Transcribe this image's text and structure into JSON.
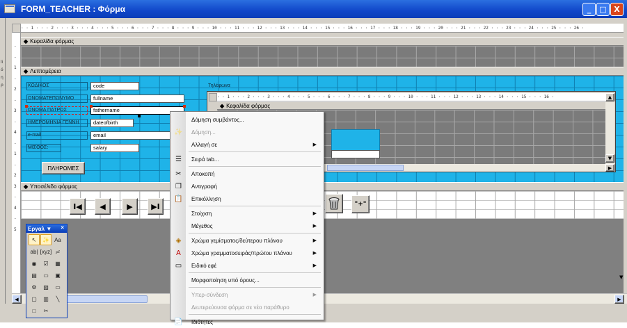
{
  "window": {
    "title": "FORM_TEACHER : Φόρμα",
    "min": "_",
    "max": "□",
    "close": "X"
  },
  "ruler": {
    "text": "· · 1 · · · 2 · · · 3 · · · 4 · · · 5 · · · 6 · · · 7 · · · 8 · · · 9 · · · 10 · · · 11 · · · 12 · · · 13 · · · 14 · · · 15 · · · 16 · · · 17 · · · 18 · · · 19 · · · 20 · · · 21 · · · 22 · · · 23 · · · 24 · · · 25 · · · 26 ·"
  },
  "sections": {
    "header": "Κεφαλίδα φόρμας",
    "detail": "Λεπτομέρεια",
    "footer": "Υποσέλιδο φόρμας"
  },
  "fields": [
    {
      "label": "ΚΩΔΙΚΟΣ",
      "value": "code"
    },
    {
      "label": "ΟΝΟΜΑΤΕΠΩΝΥΜΟ",
      "value": "fullname"
    },
    {
      "label": "ΟΝΟΜΑ ΠΑΤΡΟΣ",
      "value": "fathername"
    },
    {
      "label": "ΗΜΕΡΟΜΗΝΙΑ ΓΕΝΝΗ",
      "value": "dateofbirth"
    },
    {
      "label": "e-mail",
      "value": "email"
    },
    {
      "label": "ΜΙΣΘΟΣ:",
      "value": "salary"
    }
  ],
  "payments_button": "ΠΛΗΡΩΜΕΣ",
  "phones_label": "Τηλέφωνα",
  "subform": {
    "ruler": "· · 1 · · · 2 · · · 3 · · · 4 · · · 5 · · · 6 · · · 7 · · · 8 · · · 9 · · · 10 · · · 11 · · · 12 · · · 13 · · · 14 · · · 15 · · · 16 ·",
    "header": "Κεφαλίδα φόρμας"
  },
  "nav": {
    "first": "I◀",
    "prev": "◀",
    "next": "▶",
    "last": "▶I",
    "add": "\"+\""
  },
  "left_marks": [
    "li",
    "ό",
    "η",
    "ρ"
  ],
  "vruler": {
    "marks": [
      "-",
      "-",
      "1",
      "-",
      "2",
      "-",
      "3",
      "-",
      "4",
      "-",
      "1",
      "-",
      "2",
      "3",
      "-",
      "4",
      "-",
      "5"
    ]
  },
  "context_menu": {
    "items": [
      {
        "label": "Δόμηση συμβάντος...",
        "icon": "",
        "disabled": false,
        "arrow": false
      },
      {
        "label": "Δόμηση...",
        "icon": "wand-icon",
        "disabled": true,
        "arrow": false
      },
      {
        "label": "Αλλαγή σε",
        "icon": "",
        "disabled": false,
        "arrow": true
      },
      {
        "label": "Σειρά tab...",
        "icon": "tab-order-icon",
        "disabled": false,
        "arrow": false
      },
      {
        "label": "Αποκοπή",
        "icon": "scissors-icon",
        "disabled": false,
        "arrow": false
      },
      {
        "label": "Αντιγραφή",
        "icon": "copy-icon",
        "disabled": false,
        "arrow": false
      },
      {
        "label": "Επικόλληση",
        "icon": "paste-icon",
        "disabled": false,
        "arrow": false
      },
      {
        "label": "Στοίχιση",
        "icon": "",
        "disabled": false,
        "arrow": true
      },
      {
        "label": "Μέγεθος",
        "icon": "",
        "disabled": false,
        "arrow": true
      },
      {
        "label": "Χρώμα γεμίσματος/δεύτερου πλάνου",
        "icon": "fill-color-icon",
        "disabled": false,
        "arrow": true
      },
      {
        "label": "Χρώμα γραμματοσειράς/πρώτου πλάνου",
        "icon": "font-color-icon",
        "disabled": false,
        "arrow": true
      },
      {
        "label": "Ειδικό εφέ",
        "icon": "special-effect-icon",
        "disabled": false,
        "arrow": true
      },
      {
        "label": "Μορφοποίηση υπό όρους...",
        "icon": "",
        "disabled": false,
        "arrow": false
      },
      {
        "label": "Υπερ-σύνδεση",
        "icon": "",
        "disabled": true,
        "arrow": true
      },
      {
        "label": "Δευτερεύουσα φόρμα σε νέο παράθυρο",
        "icon": "",
        "disabled": true,
        "arrow": false
      },
      {
        "label": "Ιδιότητες",
        "icon": "properties-icon",
        "disabled": false,
        "arrow": false
      }
    ]
  },
  "toolbox": {
    "title": "Εργαλ ▼",
    "close": "×",
    "tools": [
      "↖",
      "✨",
      "Aa",
      "ab|",
      "[xyz]",
      "≓",
      "◉",
      "☑",
      "▦",
      "▤",
      "▭",
      "▣",
      "⚙",
      "▨",
      "▭",
      "▢",
      "▥",
      "╲",
      "□",
      "✂"
    ]
  },
  "colors": {
    "accent": "#0a3db8",
    "detail_bg": "#1fb3e8",
    "grid": "#7b7b7b"
  }
}
